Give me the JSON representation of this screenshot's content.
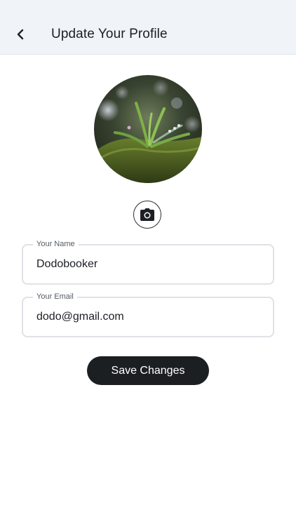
{
  "header": {
    "title": "Update Your Profile",
    "back_icon": "chevron-left-icon"
  },
  "profile": {
    "avatar_description": "profile-photo",
    "camera_icon": "camera-icon"
  },
  "form": {
    "name": {
      "label": "Your Name",
      "value": "Dodobooker"
    },
    "email": {
      "label": "Your Email",
      "value": "dodo@gmail.com"
    },
    "save_label": "Save Changes"
  },
  "colors": {
    "header_bg": "#f0f3f7",
    "button_bg": "#1c1f22",
    "field_border": "#dfe2e6"
  }
}
